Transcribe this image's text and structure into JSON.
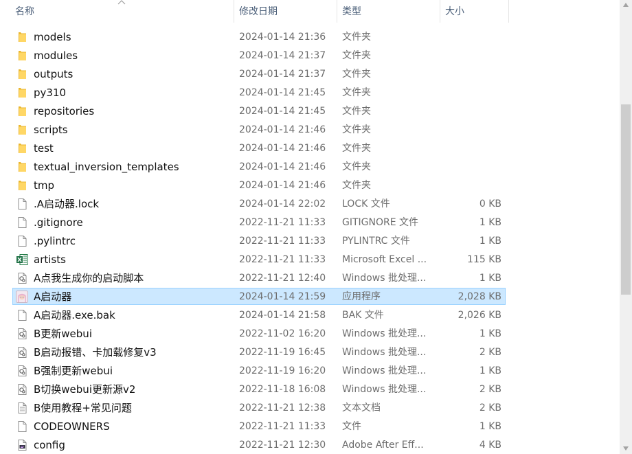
{
  "columns": {
    "name": "名称",
    "date": "修改日期",
    "type": "类型",
    "size": "大小"
  },
  "rows": [
    {
      "icon": "folder",
      "name": "models",
      "date": "2024-01-14 21:36",
      "type": "文件夹",
      "size": ""
    },
    {
      "icon": "folder",
      "name": "modules",
      "date": "2024-01-14 21:37",
      "type": "文件夹",
      "size": ""
    },
    {
      "icon": "folder",
      "name": "outputs",
      "date": "2024-01-14 21:37",
      "type": "文件夹",
      "size": ""
    },
    {
      "icon": "folder",
      "name": "py310",
      "date": "2024-01-14 21:45",
      "type": "文件夹",
      "size": ""
    },
    {
      "icon": "folder",
      "name": "repositories",
      "date": "2024-01-14 21:45",
      "type": "文件夹",
      "size": ""
    },
    {
      "icon": "folder",
      "name": "scripts",
      "date": "2024-01-14 21:46",
      "type": "文件夹",
      "size": ""
    },
    {
      "icon": "folder",
      "name": "test",
      "date": "2024-01-14 21:46",
      "type": "文件夹",
      "size": ""
    },
    {
      "icon": "folder",
      "name": "textual_inversion_templates",
      "date": "2024-01-14 21:46",
      "type": "文件夹",
      "size": ""
    },
    {
      "icon": "folder",
      "name": "tmp",
      "date": "2024-01-14 21:46",
      "type": "文件夹",
      "size": ""
    },
    {
      "icon": "file",
      "name": ".A启动器.lock",
      "date": "2024-01-14 22:02",
      "type": "LOCK 文件",
      "size": "0 KB"
    },
    {
      "icon": "file",
      "name": ".gitignore",
      "date": "2022-11-21 11:33",
      "type": "GITIGNORE 文件",
      "size": "1 KB"
    },
    {
      "icon": "file",
      "name": ".pylintrc",
      "date": "2022-11-21 11:33",
      "type": "PYLINTRC 文件",
      "size": "1 KB"
    },
    {
      "icon": "excel",
      "name": "artists",
      "date": "2022-11-21 11:33",
      "type": "Microsoft Excel ...",
      "size": "115 KB"
    },
    {
      "icon": "batch",
      "name": "A点我生成你的启动脚本",
      "date": "2022-11-21 12:40",
      "type": "Windows 批处理...",
      "size": "1 KB"
    },
    {
      "icon": "app",
      "name": "A启动器",
      "date": "2024-01-14 21:59",
      "type": "应用程序",
      "size": "2,028 KB",
      "selected": true
    },
    {
      "icon": "file",
      "name": "A启动器.exe.bak",
      "date": "2024-01-14 21:58",
      "type": "BAK 文件",
      "size": "2,026 KB"
    },
    {
      "icon": "batch",
      "name": "B更新webui",
      "date": "2022-11-02 16:20",
      "type": "Windows 批处理...",
      "size": "1 KB"
    },
    {
      "icon": "batch",
      "name": "B启动报错、卡加载修复v3",
      "date": "2022-11-19 16:45",
      "type": "Windows 批处理...",
      "size": "2 KB"
    },
    {
      "icon": "batch",
      "name": "B强制更新webui",
      "date": "2022-11-19 16:20",
      "type": "Windows 批处理...",
      "size": "1 KB"
    },
    {
      "icon": "batch",
      "name": "B切换webui更新源v2",
      "date": "2022-11-18 16:08",
      "type": "Windows 批处理...",
      "size": "2 KB"
    },
    {
      "icon": "text",
      "name": "B使用教程+常见问题",
      "date": "2022-11-21 12:38",
      "type": "文本文档",
      "size": "2 KB"
    },
    {
      "icon": "file",
      "name": "CODEOWNERS",
      "date": "2022-11-21 11:33",
      "type": "文件",
      "size": "1 KB"
    },
    {
      "icon": "aep",
      "name": "config",
      "date": "2022-11-21 12:30",
      "type": "Adobe After Eff...",
      "size": "4 KB"
    }
  ]
}
